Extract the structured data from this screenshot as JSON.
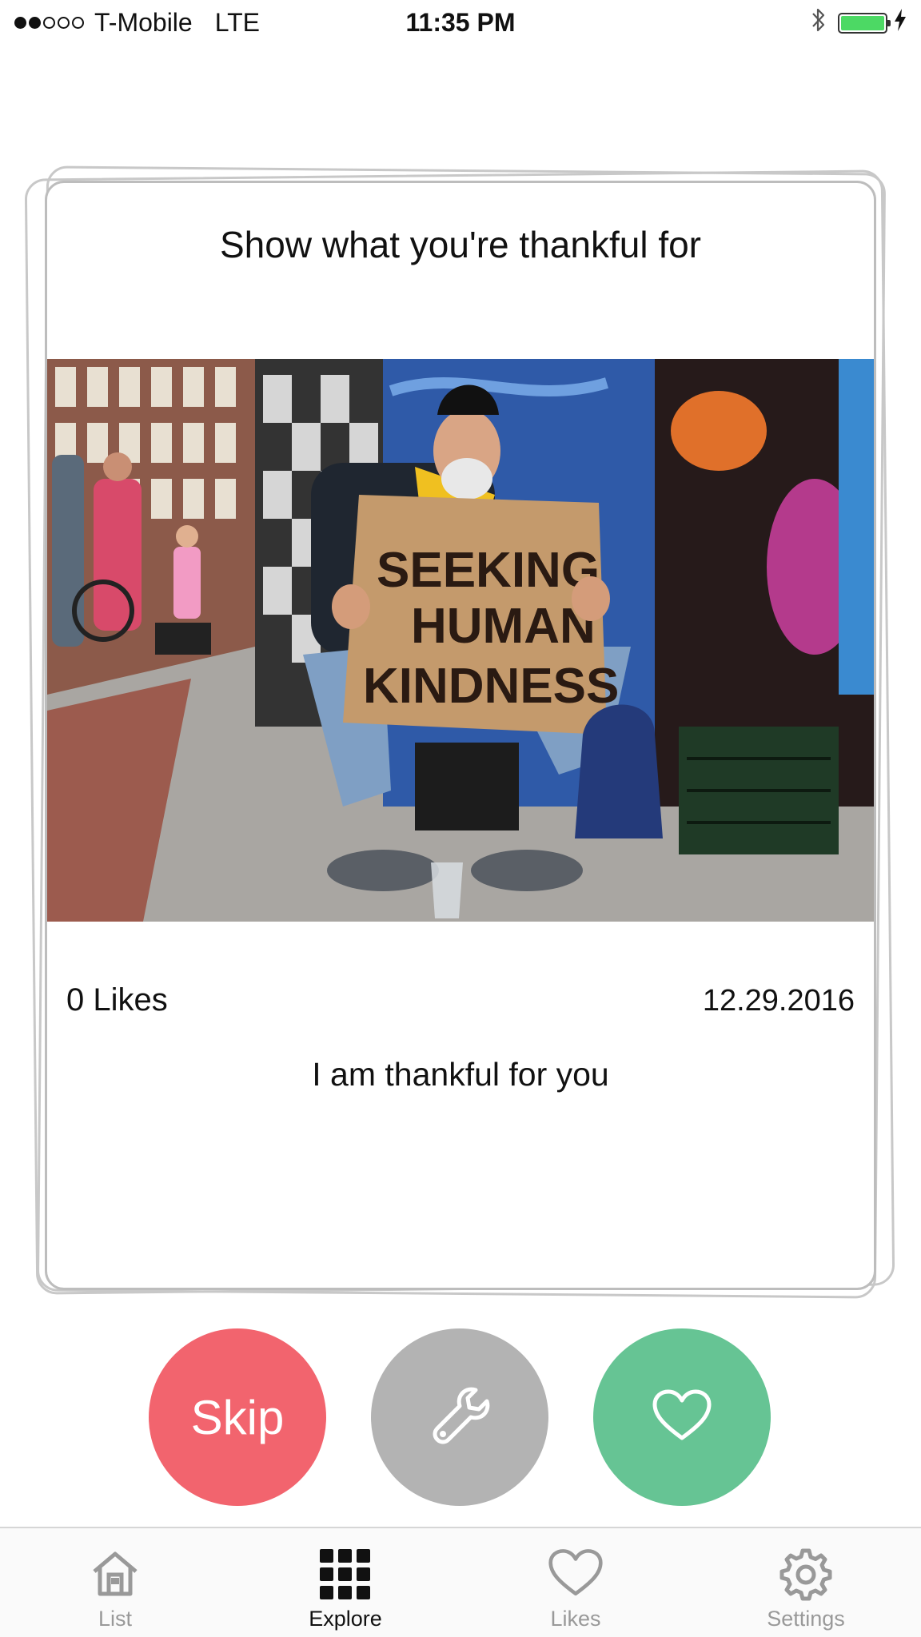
{
  "status_bar": {
    "carrier": "T-Mobile",
    "network": "LTE",
    "time": "11:35 PM",
    "signal_bars_filled": 2,
    "signal_bars_total": 5,
    "battery_level": 1.0,
    "battery_color": "#4cd964",
    "icons": [
      "bluetooth-icon",
      "battery-icon",
      "charging-bolt-icon"
    ]
  },
  "card": {
    "title": "Show what you're thankful for",
    "photo_sign_lines": [
      "SEEKING",
      "HUMAN",
      "KINDNESS"
    ],
    "likes": "0 Likes",
    "date": "12.29.2016",
    "message": "I am thankful for you"
  },
  "actions": {
    "skip_label": "Skip",
    "skip_color": "#f2646e",
    "tool_icon": "wrench-icon",
    "tool_color": "#b3b3b3",
    "like_icon": "heart-icon",
    "like_color": "#66c494"
  },
  "tabs": [
    {
      "label": "List",
      "icon": "home-icon",
      "active": false
    },
    {
      "label": "Explore",
      "icon": "grid-icon",
      "active": true
    },
    {
      "label": "Likes",
      "icon": "heart-icon",
      "active": false
    },
    {
      "label": "Settings",
      "icon": "gear-icon",
      "active": false
    }
  ]
}
